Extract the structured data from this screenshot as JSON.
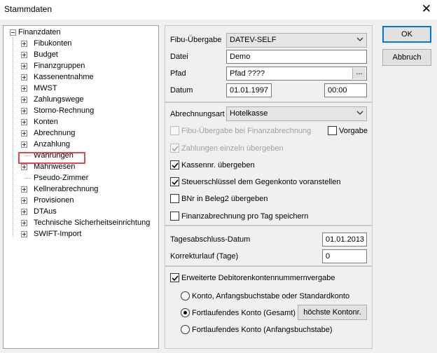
{
  "window": {
    "title": "Stammdaten",
    "close_glyph": "✕"
  },
  "tree": {
    "root": "Finanzdaten",
    "items": [
      {
        "label": "Fibukonten",
        "expandable": true
      },
      {
        "label": "Budget",
        "expandable": true
      },
      {
        "label": "Finanzgruppen",
        "expandable": true
      },
      {
        "label": "Kassenentnahme",
        "expandable": true
      },
      {
        "label": "MWST",
        "expandable": true
      },
      {
        "label": "Zahlungswege",
        "expandable": true
      },
      {
        "label": "Storno-Rechnung",
        "expandable": true
      },
      {
        "label": "Konten",
        "expandable": true
      },
      {
        "label": "Abrechnung",
        "expandable": true,
        "highlighted": true
      },
      {
        "label": "Anzahlung",
        "expandable": true
      },
      {
        "label": "Währungen",
        "expandable": false
      },
      {
        "label": "Mahnwesen",
        "expandable": true
      },
      {
        "label": "Pseudo-Zimmer",
        "expandable": false
      },
      {
        "label": "Kellnerabrechnung",
        "expandable": true
      },
      {
        "label": "Provisionen",
        "expandable": true
      },
      {
        "label": "DTAus",
        "expandable": true
      },
      {
        "label": "Technische Sicherheitseinrichtung",
        "expandable": true
      },
      {
        "label": "SWIFT-Import",
        "expandable": true
      }
    ]
  },
  "fibu": {
    "label_fibu": "Fibu-Übergabe",
    "fibu_value": "DATEV-SELF",
    "label_datei": "Datei",
    "datei_value": "Demo",
    "label_pfad": "Pfad",
    "pfad_value": "Pfad ????",
    "pfad_browse": "...",
    "label_datum": "Datum",
    "datum_value": "01.01.1997",
    "zeit_value": "00:00"
  },
  "abrechnung": {
    "label_art": "Abrechnungsart",
    "art_value": "Hotelkasse",
    "cb_fibu": "Fibu-Übergabe bei Finanzabrechnung",
    "cb_vorgabe": "Vorgabe",
    "cb_zahlungen": "Zahlungen einzeln übergeben",
    "cb_kassennr": "Kassennr. übergeben",
    "cb_steuer": "Steuerschlüssel dem Gegenkonto voranstellen",
    "cb_bnr": "BNr in Beleg2 übergeben",
    "cb_pro_tag": "Finanzabrechnung pro Tag speichern"
  },
  "tagesabschluss": {
    "label_datum": "Tagesabschluss-Datum",
    "datum_value": "01.01.2013",
    "label_korrektur": "Korrekturlauf (Tage)",
    "korrektur_value": "0"
  },
  "debitoren": {
    "cb_label": "Erweiterte Debitorenkontennummernvergabe",
    "radio1": "Konto, Anfangsbuchstabe oder Standardkonto",
    "radio2": "Fortlaufendes Konto (Gesamt)",
    "radio3": "Fortlaufendes Konto (Anfangsbuchstabe)",
    "btn_hoechste": "höchste Kontonr."
  },
  "buttons": {
    "ok": "OK",
    "cancel": "Abbruch"
  }
}
